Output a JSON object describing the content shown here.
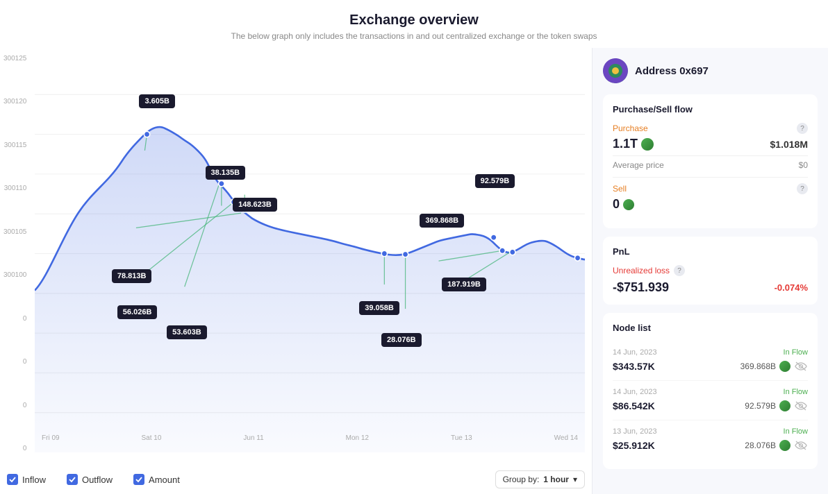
{
  "header": {
    "title": "Exchange overview",
    "subtitle": "The below graph only includes the transactions in and out centralized exchange or the token swaps"
  },
  "chart": {
    "y_labels": [
      "300125",
      "300120",
      "300115",
      "300110",
      "300105",
      "300100",
      "0",
      "0",
      "0",
      "0"
    ],
    "x_labels": [
      "Fri 09",
      "Sat 10",
      "Jun 11",
      "Mon 12",
      "Tue 13",
      "Wed 14"
    ],
    "tooltips": [
      {
        "label": "3.605B",
        "x_pct": 19,
        "y_pct": 12
      },
      {
        "label": "38.135B",
        "x_pct": 34,
        "y_pct": 31
      },
      {
        "label": "148.623B",
        "x_pct": 38,
        "y_pct": 38
      },
      {
        "label": "78.813B",
        "x_pct": 18,
        "y_pct": 58
      },
      {
        "label": "56.026B",
        "x_pct": 19,
        "y_pct": 67
      },
      {
        "label": "53.603B",
        "x_pct": 27,
        "y_pct": 71
      },
      {
        "label": "39.058B",
        "x_pct": 63,
        "y_pct": 67
      },
      {
        "label": "28.076B",
        "x_pct": 67,
        "y_pct": 74
      },
      {
        "label": "369.868B",
        "x_pct": 73,
        "y_pct": 45
      },
      {
        "label": "187.919B",
        "x_pct": 77,
        "y_pct": 60
      },
      {
        "label": "92.579B",
        "x_pct": 83,
        "y_pct": 37
      }
    ]
  },
  "legend": {
    "inflow_label": "Inflow",
    "outflow_label": "Outflow",
    "amount_label": "Amount",
    "group_by_label": "Group by:",
    "group_by_value": "1 hour"
  },
  "right_panel": {
    "address": "Address 0x697",
    "sections": {
      "purchase_sell": {
        "title": "Purchase/Sell flow",
        "purchase_label": "Purchase",
        "purchase_amount": "1.1T",
        "purchase_usd": "$1.018M",
        "avg_price_label": "Average price",
        "avg_price_value": "$0",
        "sell_label": "Sell",
        "sell_amount": "0"
      },
      "pnl": {
        "title": "PnL",
        "unrealized_loss_label": "Unrealized loss",
        "unrealized_loss_value": "-$751.939",
        "unrealized_loss_pct": "-0.074%"
      },
      "node_list": {
        "title": "Node list",
        "items": [
          {
            "date": "14 Jun, 2023",
            "flow": "In Flow",
            "usd": "$343.57K",
            "token_amount": "369.868B"
          },
          {
            "date": "14 Jun, 2023",
            "flow": "In Flow",
            "usd": "$86.542K",
            "token_amount": "92.579B"
          },
          {
            "date": "13 Jun, 2023",
            "flow": "In Flow",
            "usd": "$25.912K",
            "token_amount": "28.076B"
          }
        ]
      }
    }
  }
}
